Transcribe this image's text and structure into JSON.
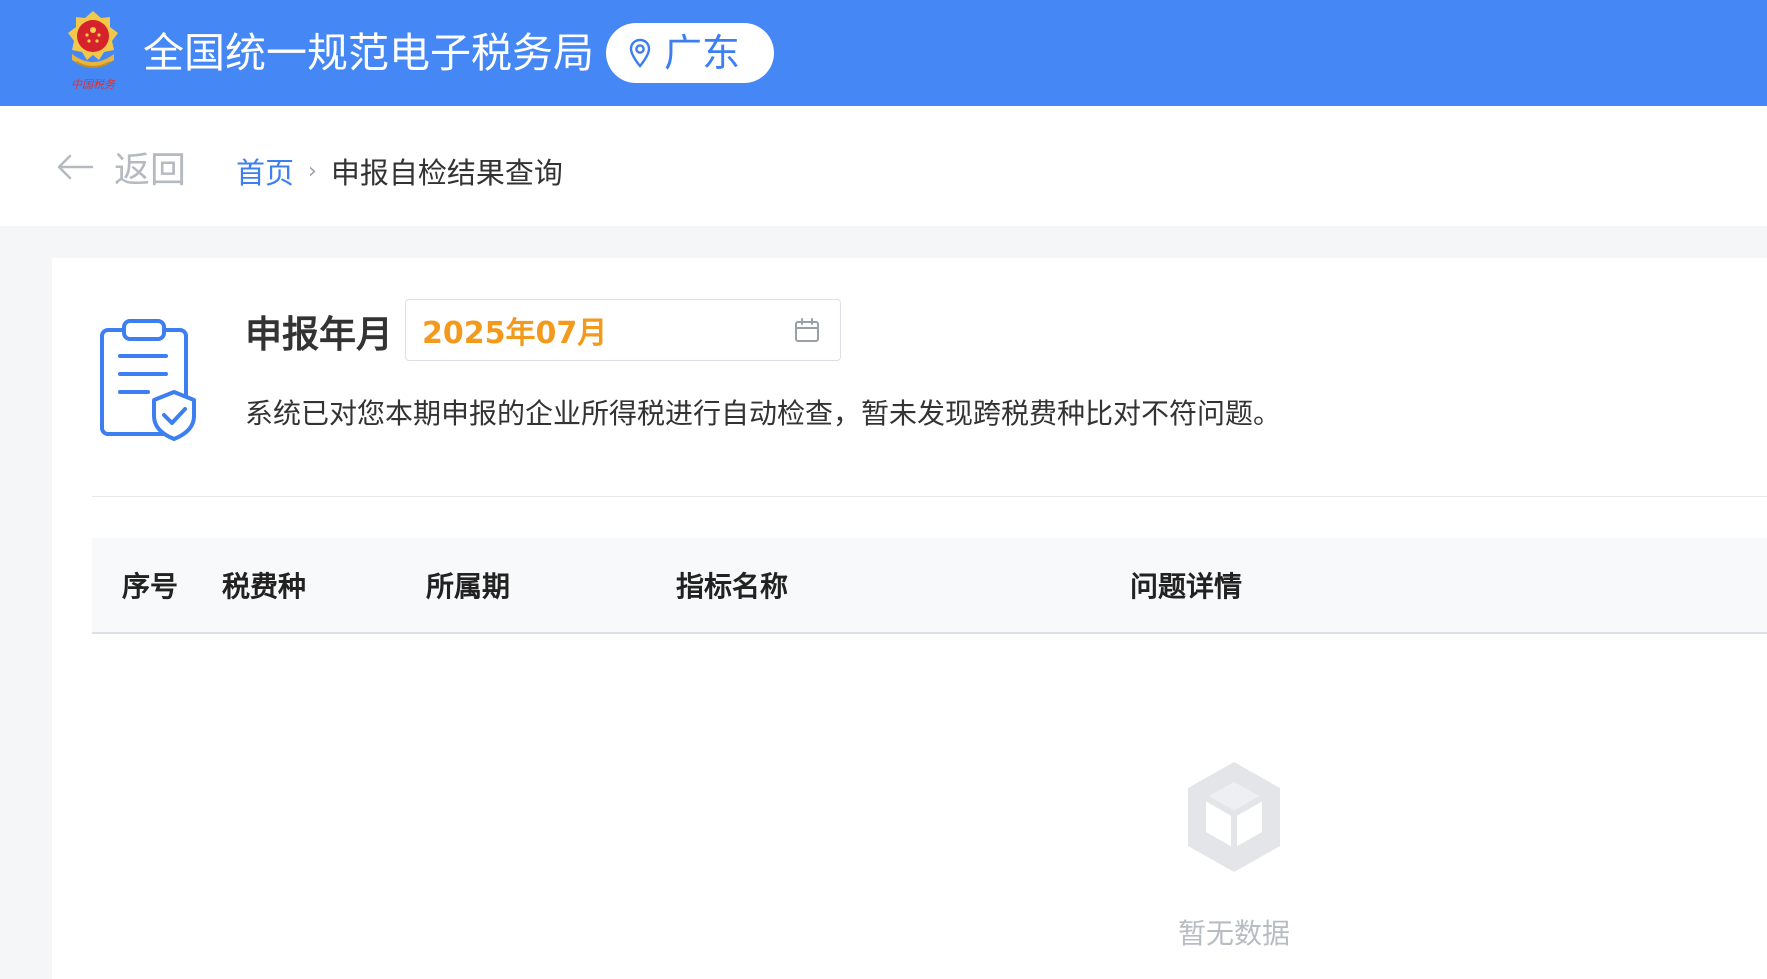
{
  "header": {
    "site_title": "全国统一规范电子税务局",
    "region": "广东",
    "emblem_caption": "中国税务",
    "brand_color": "#4487f5"
  },
  "nav": {
    "back_label": "返回",
    "breadcrumb_home": "首页",
    "breadcrumb_separator": "›",
    "breadcrumb_current": "申报自检结果查询"
  },
  "query": {
    "period_label": "申报年月",
    "period_value": "2025年07月",
    "period_value_color": "#f39a1c",
    "notice": "系统已对您本期申报的企业所得税进行自动检查，暂未发现跨税费种比对不符问题。"
  },
  "table": {
    "columns": [
      "序号",
      "税费种",
      "所属期",
      "指标名称",
      "问题详情"
    ],
    "rows": [],
    "empty_text": "暂无数据"
  },
  "icons": {
    "emblem": "national-tax-emblem-icon",
    "region": "location-pin-icon",
    "back": "arrow-left-icon",
    "calendar": "calendar-icon",
    "report": "clipboard-shield-check-icon",
    "empty": "empty-box-icon"
  }
}
